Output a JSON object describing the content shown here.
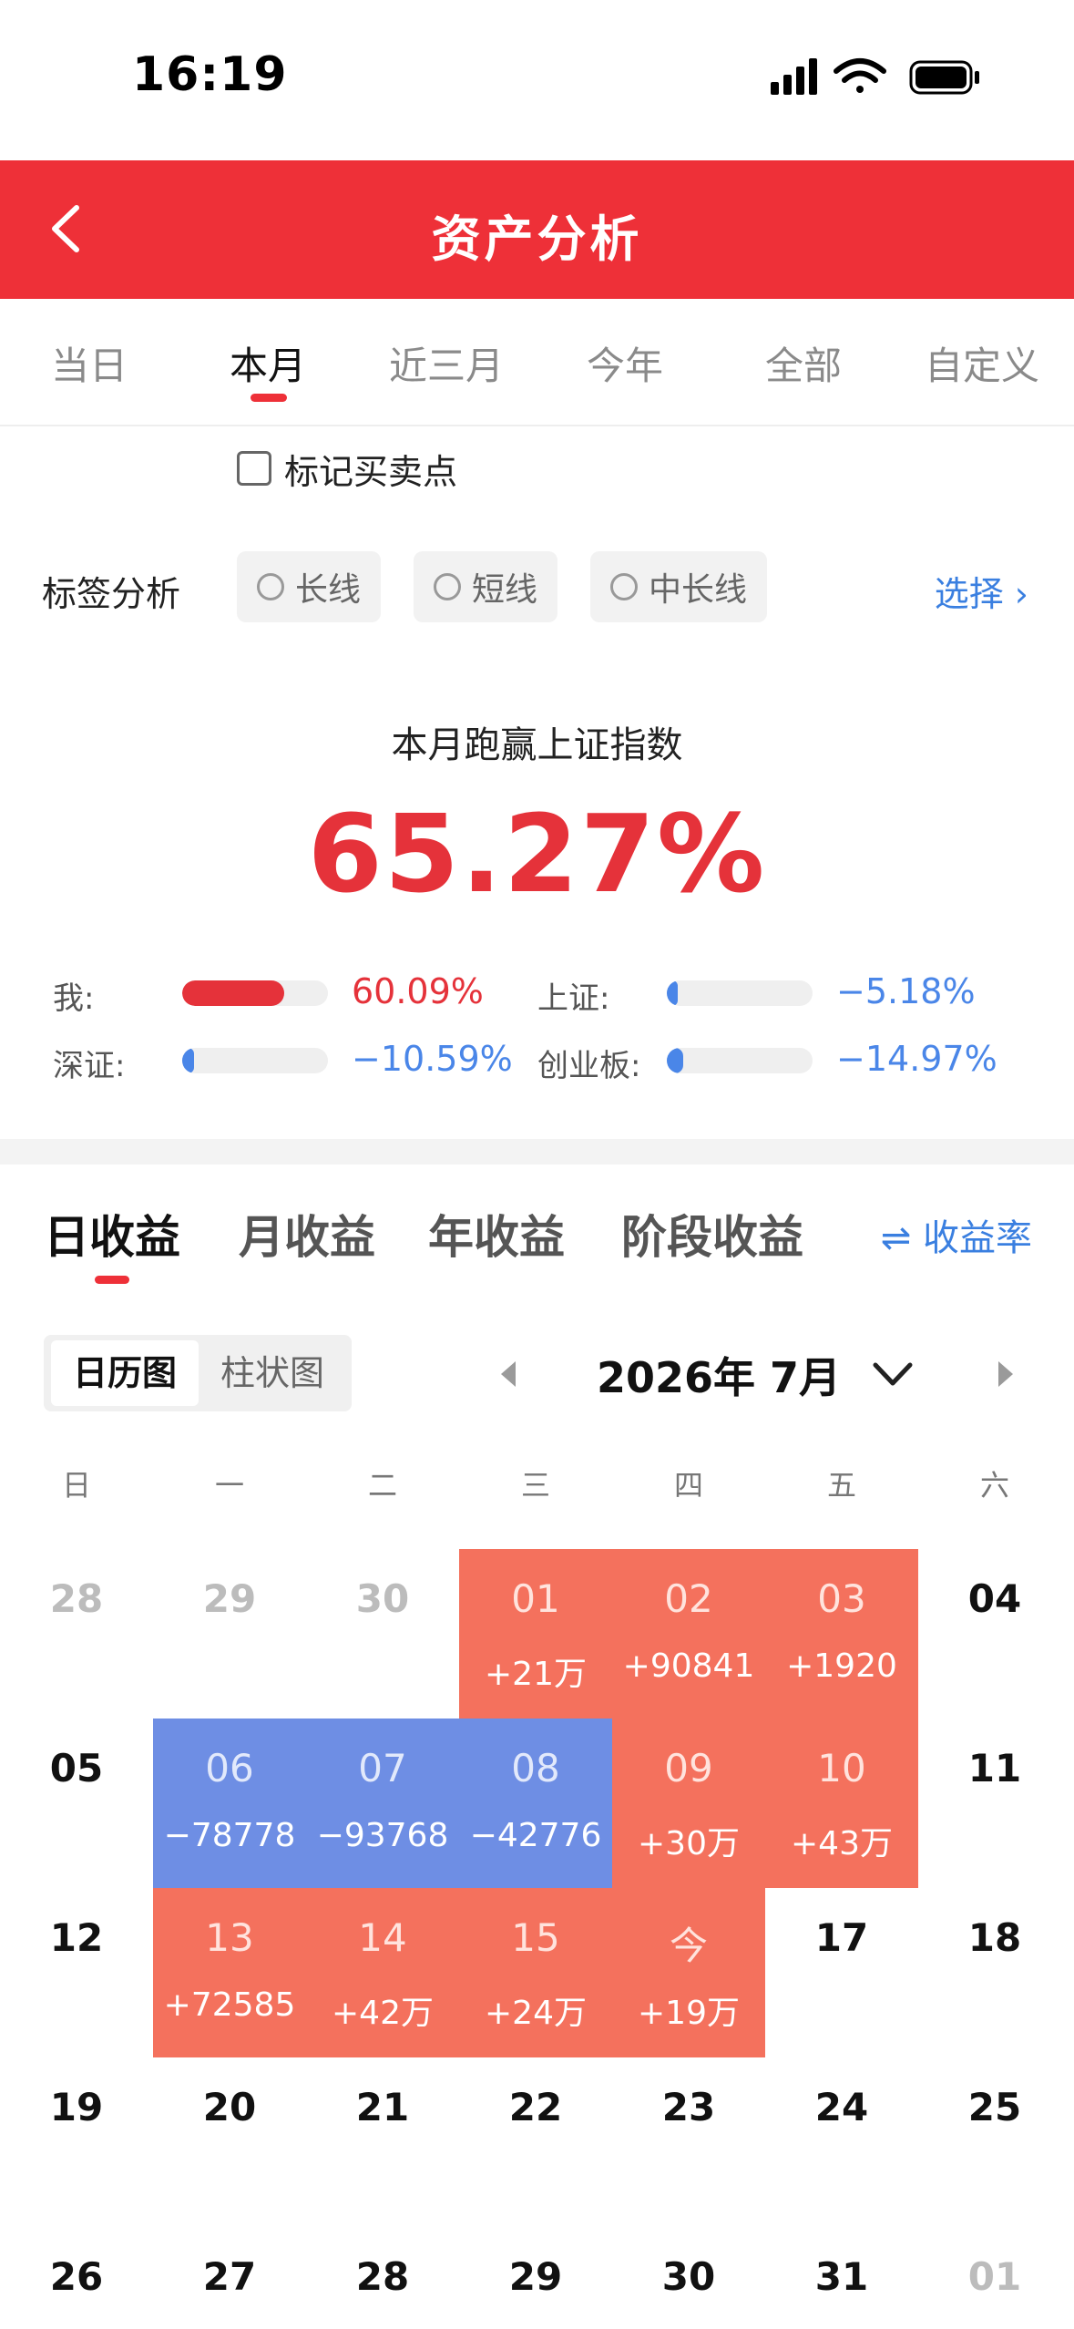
{
  "status": {
    "time": "16:19"
  },
  "header": {
    "title": "资产分析"
  },
  "period_tabs": [
    "当日",
    "本月",
    "近三月",
    "今年",
    "全部",
    "自定义"
  ],
  "active_period": "本月",
  "mark_points_label": "标记买卖点",
  "tag_analysis": {
    "title": "标签分析",
    "chips": [
      "长线",
      "短线",
      "中长线"
    ],
    "select_label": "选择 ›"
  },
  "summary": {
    "title": "本月跑赢上证指数",
    "value": "65.27%"
  },
  "comparisons": [
    {
      "label": "我:",
      "value": "60.09%",
      "color": "#e5323a",
      "level": 0.7
    },
    {
      "label": "上证:",
      "value": "−5.18%",
      "color": "#4a86e8",
      "level": 0.04
    },
    {
      "label": "深证:",
      "value": "−10.59%",
      "color": "#4a86e8",
      "level": 0.08
    },
    {
      "label": "创业板:",
      "value": "−14.97%",
      "color": "#4a86e8",
      "level": 0.11
    }
  ],
  "earnings_tabs": [
    "日收益",
    "月收益",
    "年收益",
    "阶段收益"
  ],
  "rate_link": "⇌ 收益率",
  "view_toggle": [
    "日历图",
    "柱状图"
  ],
  "month_label": "2026年 7月",
  "weekdays": [
    "日",
    "一",
    "二",
    "三",
    "四",
    "五",
    "六"
  ],
  "calendar": [
    [
      {
        "d": "28",
        "s": "dim"
      },
      {
        "d": "29",
        "s": "dim"
      },
      {
        "d": "30",
        "s": "dim"
      },
      {
        "d": "01",
        "s": "pos",
        "a": "+21万"
      },
      {
        "d": "02",
        "s": "pos",
        "a": "+90841"
      },
      {
        "d": "03",
        "s": "pos",
        "a": "+1920"
      },
      {
        "d": "04",
        "s": "plain"
      }
    ],
    [
      {
        "d": "05",
        "s": "plain"
      },
      {
        "d": "06",
        "s": "neg",
        "a": "−78778"
      },
      {
        "d": "07",
        "s": "neg",
        "a": "−93768"
      },
      {
        "d": "08",
        "s": "neg",
        "a": "−42776"
      },
      {
        "d": "09",
        "s": "pos",
        "a": "+30万"
      },
      {
        "d": "10",
        "s": "pos",
        "a": "+43万"
      },
      {
        "d": "11",
        "s": "plain"
      }
    ],
    [
      {
        "d": "12",
        "s": "plain"
      },
      {
        "d": "13",
        "s": "pos",
        "a": "+72585"
      },
      {
        "d": "14",
        "s": "pos",
        "a": "+42万"
      },
      {
        "d": "15",
        "s": "pos",
        "a": "+24万"
      },
      {
        "d": "今",
        "s": "pos",
        "a": "+19万"
      },
      {
        "d": "17",
        "s": "plain"
      },
      {
        "d": "18",
        "s": "plain"
      }
    ],
    [
      {
        "d": "19",
        "s": "plain"
      },
      {
        "d": "20",
        "s": "plain"
      },
      {
        "d": "21",
        "s": "plain"
      },
      {
        "d": "22",
        "s": "plain"
      },
      {
        "d": "23",
        "s": "plain"
      },
      {
        "d": "24",
        "s": "plain"
      },
      {
        "d": "25",
        "s": "plain"
      }
    ],
    [
      {
        "d": "26",
        "s": "plain"
      },
      {
        "d": "27",
        "s": "plain"
      },
      {
        "d": "28",
        "s": "plain"
      },
      {
        "d": "29",
        "s": "plain"
      },
      {
        "d": "30",
        "s": "plain"
      },
      {
        "d": "31",
        "s": "plain"
      },
      {
        "d": "01",
        "s": "dim"
      }
    ]
  ]
}
